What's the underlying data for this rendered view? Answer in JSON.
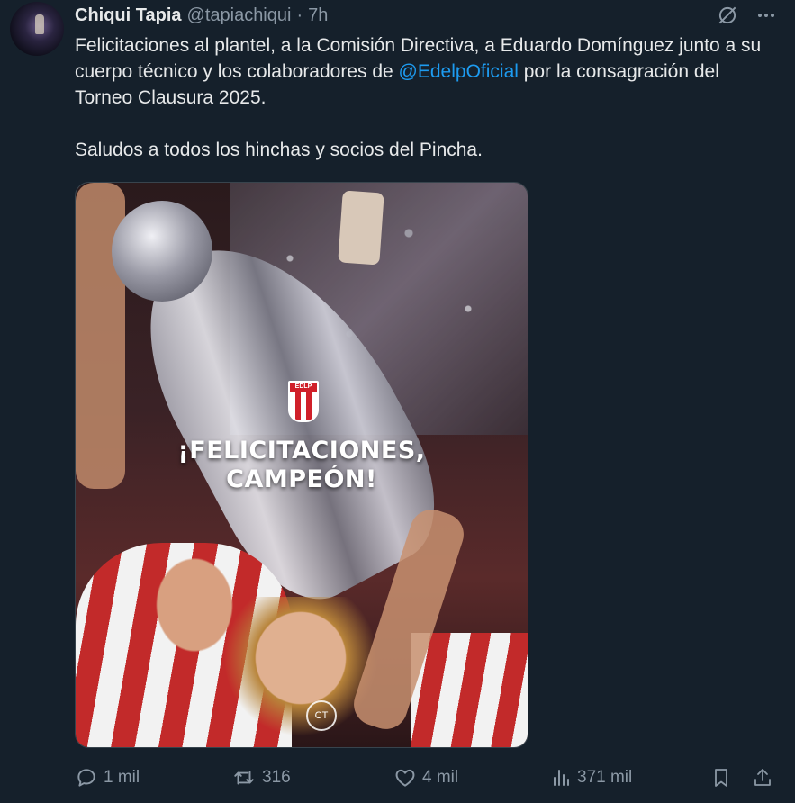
{
  "tweet": {
    "author_name": "Chiqui Tapia",
    "handle": "@tapiachiqui",
    "separator": "·",
    "time": "7h",
    "text_line1_part1": "Felicitaciones al plantel, a la Comisión Directiva, a Eduardo Domínguez junto a su cuerpo técnico y los colaboradores de ",
    "mention": "@EdelpOficial",
    "text_line1_part2": " por la consagración del Torneo Clausura 2025.",
    "text_paragraph2": "Saludos a todos los hinchas y socios del Pincha."
  },
  "media": {
    "headline_line1": "¡FELICITACIONES,",
    "headline_line2": "CAMPEÓN!",
    "badge_text": "EDLP",
    "watermark": "CT"
  },
  "actions": {
    "replies": "1 mil",
    "retweets": "316",
    "likes": "4 mil",
    "views": "371 mil"
  },
  "icons": {
    "grok": "grok-icon",
    "more": "more-icon",
    "reply": "reply-icon",
    "retweet": "retweet-icon",
    "like": "heart-icon",
    "views": "views-icon",
    "bookmark": "bookmark-icon",
    "share": "share-icon"
  },
  "colors": {
    "background": "#15202b",
    "text": "#e7e9ea",
    "secondary": "#8b98a5",
    "accent": "#1d9bf0"
  }
}
